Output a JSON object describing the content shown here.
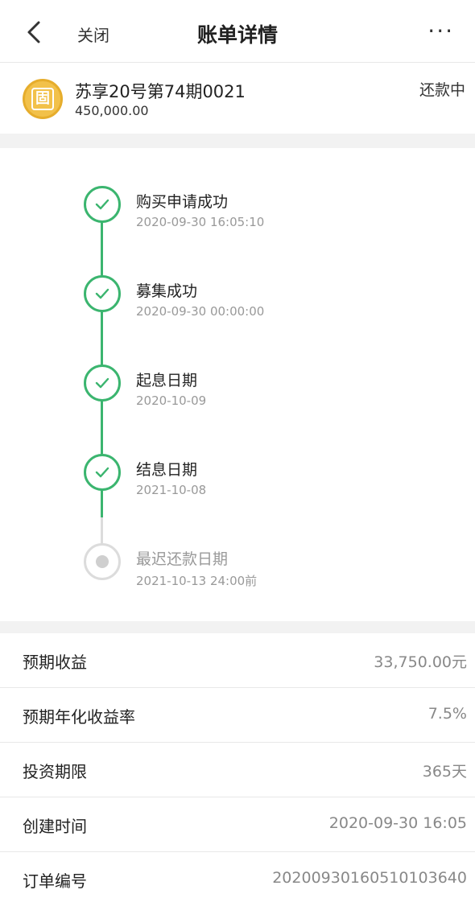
{
  "header": {
    "title": "账单详情",
    "close_label": "关闭",
    "more_label": "···"
  },
  "product": {
    "icon": "coin-icon",
    "icon_glyph": "固",
    "name": "苏享20号第74期0021",
    "amount": "450,000.00",
    "status": "还款中"
  },
  "timeline": [
    {
      "label": "购买申请成功",
      "time": "2020-09-30 16:05:10",
      "done": true
    },
    {
      "label": "募集成功",
      "time": "2020-09-30 00:00:00",
      "done": true
    },
    {
      "label": "起息日期",
      "time": "2020-10-09",
      "done": true
    },
    {
      "label": "结息日期",
      "time": "2021-10-08",
      "done": true
    },
    {
      "label": "最迟还款日期",
      "time": "2021-10-13 24:00前",
      "done": false
    }
  ],
  "details": [
    {
      "label": "预期收益",
      "value": "33,750.00元"
    },
    {
      "label": "预期年化收益率",
      "value": "7.5%"
    },
    {
      "label": "投资期限",
      "value": "365天"
    },
    {
      "label": "创建时间",
      "value": "2020-09-30 16:05"
    },
    {
      "label": "订单编号",
      "value": "20200930160510103640"
    }
  ],
  "colors": {
    "accent_green": "#3bb56f",
    "coin_gold": "#f2c14a"
  }
}
